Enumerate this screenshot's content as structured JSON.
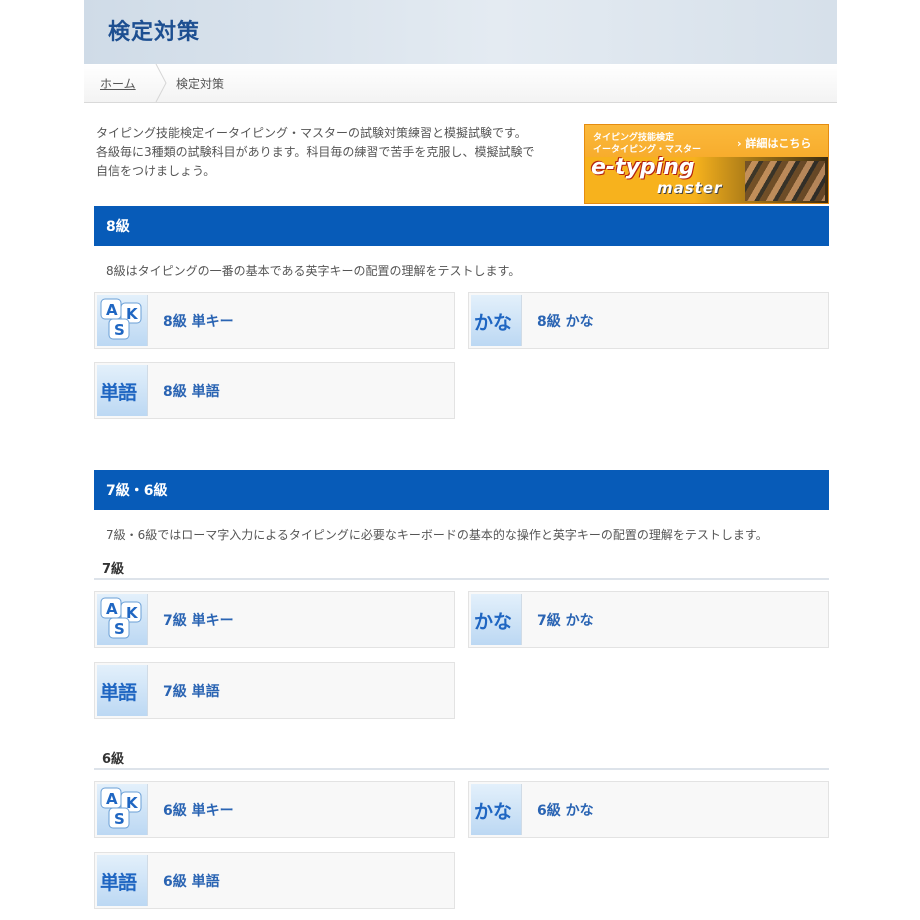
{
  "header": {
    "title": "検定対策"
  },
  "breadcrumb": {
    "home": "ホーム",
    "current": "検定対策"
  },
  "intro": {
    "lines": [
      "タイピング技能検定イータイピング・マスターの試験対策練習と模擬試験です。",
      "各級毎に3種類の試験科目があります。科目毎の練習で苦手を克服し、模擬試験で",
      "自信をつけましょう。"
    ]
  },
  "banner": {
    "line1": "タイピング技能検定",
    "line2": "イータイピング・マスター",
    "more": "詳細はこちら",
    "brand_top": "e-typing",
    "brand_bottom": "master"
  },
  "icons": {
    "aks": [
      "A",
      "K",
      "S"
    ],
    "kana": "かな",
    "word": "単語"
  },
  "sections": [
    {
      "title": "8級",
      "desc": "8級はタイピングの一番の基本である英字キーの配置の理解をテストします。",
      "cards": {
        "single": "8級 単キー",
        "kana": "8級 かな",
        "word": "8級 単語"
      }
    },
    {
      "title": "7級・6級",
      "desc": "7級・6級ではローマ字入力によるタイピングに必要なキーボードの基本的な操作と英字キーの配置の理解をテストします。",
      "levels": [
        {
          "title": "7級",
          "cards": {
            "single": "7級 単キー",
            "kana": "7級 かな",
            "word": "7級 単語"
          }
        },
        {
          "title": "6級",
          "cards": {
            "single": "6級 単キー",
            "kana": "6級 かな",
            "word": "6級 単語"
          }
        }
      ]
    }
  ],
  "colors": {
    "section_bar": "#075bb8",
    "link": "#2a64b3",
    "title": "#1d4f91",
    "banner": "#f29a17"
  }
}
